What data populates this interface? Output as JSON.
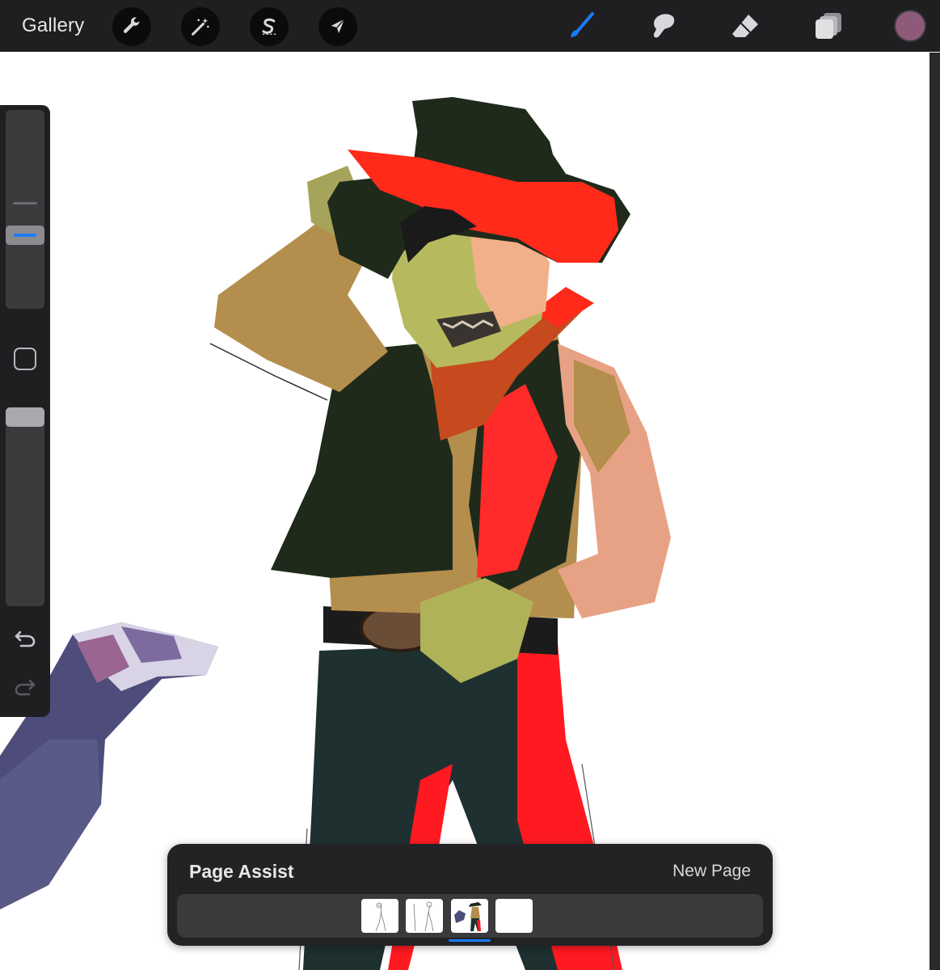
{
  "toolbar": {
    "gallery_label": "Gallery",
    "left_tools": [
      {
        "name": "wrench-icon",
        "action": "actions"
      },
      {
        "name": "magic-wand-icon",
        "action": "adjustments"
      },
      {
        "name": "selection-s-icon",
        "action": "selection"
      },
      {
        "name": "arrow-cursor-icon",
        "action": "transform"
      }
    ],
    "right_tools": [
      {
        "name": "brush-icon",
        "active": true
      },
      {
        "name": "smudge-icon",
        "active": false
      },
      {
        "name": "eraser-icon",
        "active": false
      },
      {
        "name": "layers-icon",
        "active": false
      }
    ],
    "current_color": "#8e5a79",
    "accent_color": "#1a7cff"
  },
  "sidebar": {
    "brush_size_level": 0.3,
    "brush_opacity_level": 1.0
  },
  "page_assist": {
    "title": "Page Assist",
    "new_page_label": "New Page",
    "page_count": 4,
    "active_page_index": 2
  }
}
